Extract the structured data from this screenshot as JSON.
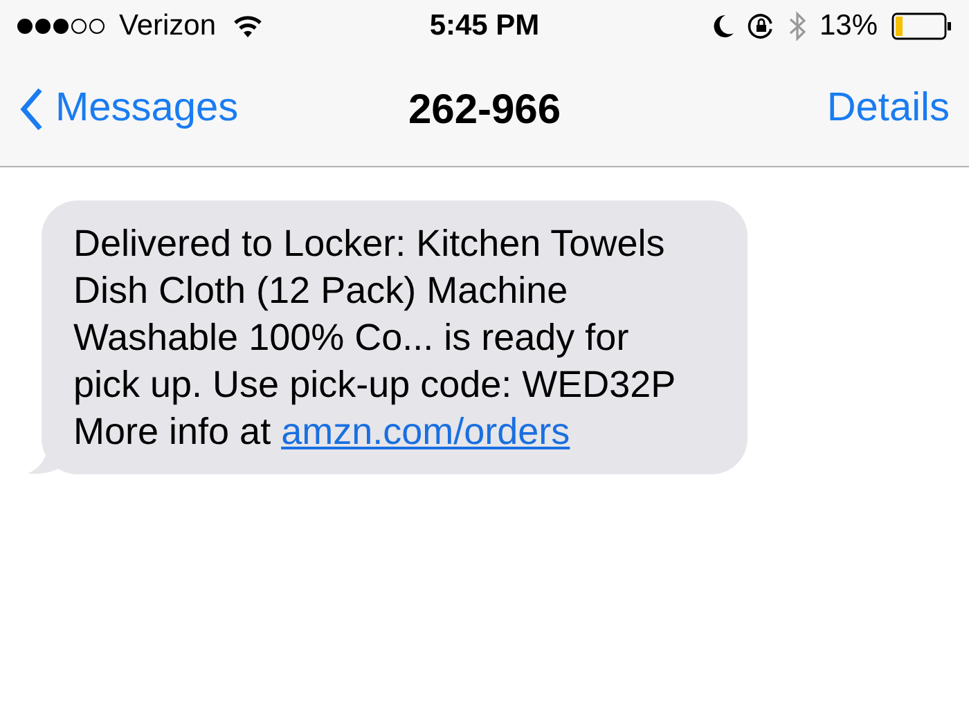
{
  "status_bar": {
    "carrier": "Verizon",
    "time": "5:45 PM",
    "battery": "13%"
  },
  "nav": {
    "back": "Messages",
    "title": "262-966",
    "action": "Details"
  },
  "messages": [
    {
      "kind": "incoming",
      "text": "Delivered to Locker: Kitchen Towels Dish Cloth (12 Pack) Machine Washable 100% Co... is ready for pick up. Use pick-up code: WED32P More info at ",
      "link": "amzn.com/orders"
    }
  ]
}
